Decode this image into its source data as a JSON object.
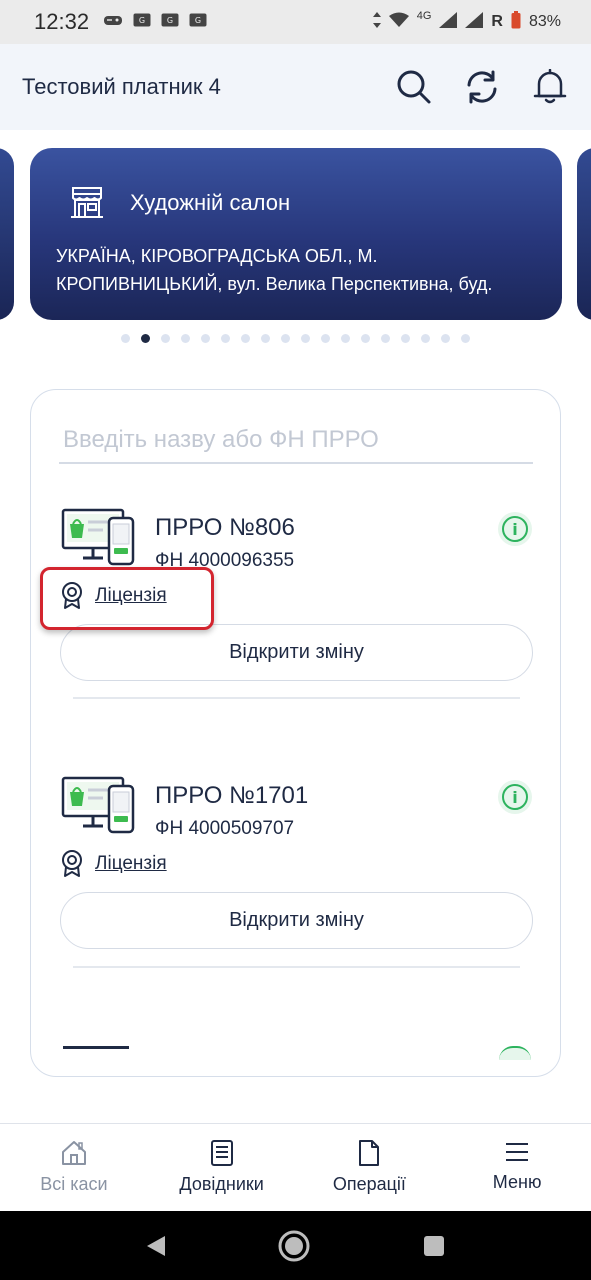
{
  "status_bar": {
    "time": "12:32",
    "network": "4G",
    "roaming": "R",
    "battery": "83%"
  },
  "header": {
    "title": "Тестовий платник 4"
  },
  "store": {
    "name": "Художній салон",
    "address_line1": "УКРАЇНА, КІРОВОГРАДСЬКА ОБЛ., М.",
    "address_line2": "КРОПИВНИЦЬКИЙ, вул. Велика Перспективна, буд."
  },
  "search": {
    "placeholder": "Введіть назву або ФН ПРРО"
  },
  "kassas": [
    {
      "title": "ПРРО №806",
      "fn": "ФН 4000096355",
      "license_label": "Ліцензія",
      "open_label": "Відкрити зміну"
    },
    {
      "title": "ПРРО №1701",
      "fn": "ФН 4000509707",
      "license_label": "Ліцензія",
      "open_label": "Відкрити зміну"
    }
  ],
  "bottom_nav": {
    "items": [
      {
        "label": "Всі каси",
        "icon": "home-icon"
      },
      {
        "label": "Довідники",
        "icon": "document-list-icon"
      },
      {
        "label": "Операції",
        "icon": "file-icon"
      },
      {
        "label": "Меню",
        "icon": "menu-icon"
      }
    ]
  },
  "colors": {
    "card_top": "#3a53a0",
    "card_bottom": "#1b2657",
    "text": "#1f2a44",
    "accent_green": "#2db35e",
    "highlight": "#d3252f"
  }
}
